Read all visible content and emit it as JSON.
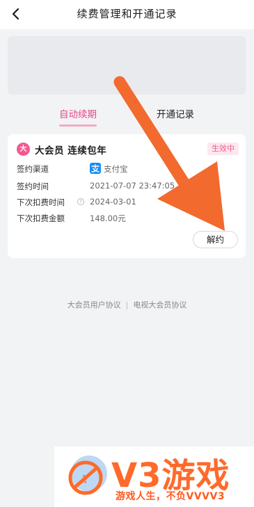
{
  "header": {
    "title": "续费管理和开通记录"
  },
  "tabs": [
    {
      "label": "自动续期",
      "active": true
    },
    {
      "label": "开通记录",
      "active": false
    }
  ],
  "subscription": {
    "badge_char": "大",
    "title": "大会员 连续包年",
    "status": "生效中",
    "rows": [
      {
        "label": "签约渠道",
        "value": "支付宝"
      },
      {
        "label": "签约时间",
        "value": "2021-07-07 23:47:05"
      },
      {
        "label": "下次扣费时间",
        "value": "2024-03-01"
      },
      {
        "label": "下次扣费金额",
        "value": "148.00元"
      }
    ],
    "cancel_label": "解约"
  },
  "footer": {
    "link1": "大会员用户协议",
    "separator": "|",
    "link2": "电视大会员协议"
  },
  "watermark": {
    "brand": "V3游戏",
    "slogan": "游戏人生，不负VVVV3"
  },
  "colors": {
    "accent_pink": "#e5488b",
    "arrow_orange": "#f26a2e",
    "watermark_orange": "#ff6a2a"
  }
}
